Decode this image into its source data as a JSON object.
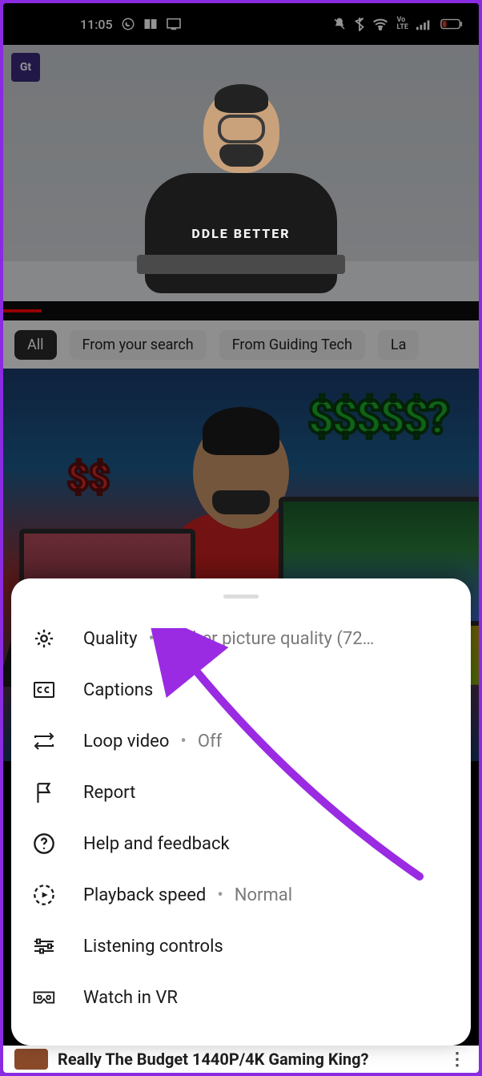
{
  "status": {
    "time": "11:05",
    "left_icons": [
      "whatsapp-icon",
      "book-icon",
      "cast-icon"
    ],
    "right_icons": [
      "mute-icon",
      "bluetooth-icon",
      "wifi-icon",
      "volte-icon",
      "signal-icon",
      "battery-low-icon"
    ]
  },
  "player": {
    "watermark": "Gt",
    "shirt_text": "DDLE BETTER"
  },
  "chips": [
    "All",
    "From your search",
    "From Guiding Tech",
    "La"
  ],
  "rec_thumb": {
    "dollars_big": "$$$$$?",
    "dollars_small": "$$"
  },
  "sheet": {
    "items": [
      {
        "icon": "gear-icon",
        "label": "Quality",
        "value": "Higher picture quality (72…"
      },
      {
        "icon": "cc-icon",
        "label": "Captions",
        "value": ""
      },
      {
        "icon": "loop-icon",
        "label": "Loop video",
        "value": "Off"
      },
      {
        "icon": "flag-icon",
        "label": "Report",
        "value": ""
      },
      {
        "icon": "help-icon",
        "label": "Help and feedback",
        "value": ""
      },
      {
        "icon": "speed-icon",
        "label": "Playback speed",
        "value": "Normal"
      },
      {
        "icon": "sliders-icon",
        "label": "Listening controls",
        "value": ""
      },
      {
        "icon": "vr-icon",
        "label": "Watch in VR",
        "value": ""
      }
    ]
  },
  "peek": {
    "title": "Really The Budget 1440P/4K Gaming King?"
  }
}
